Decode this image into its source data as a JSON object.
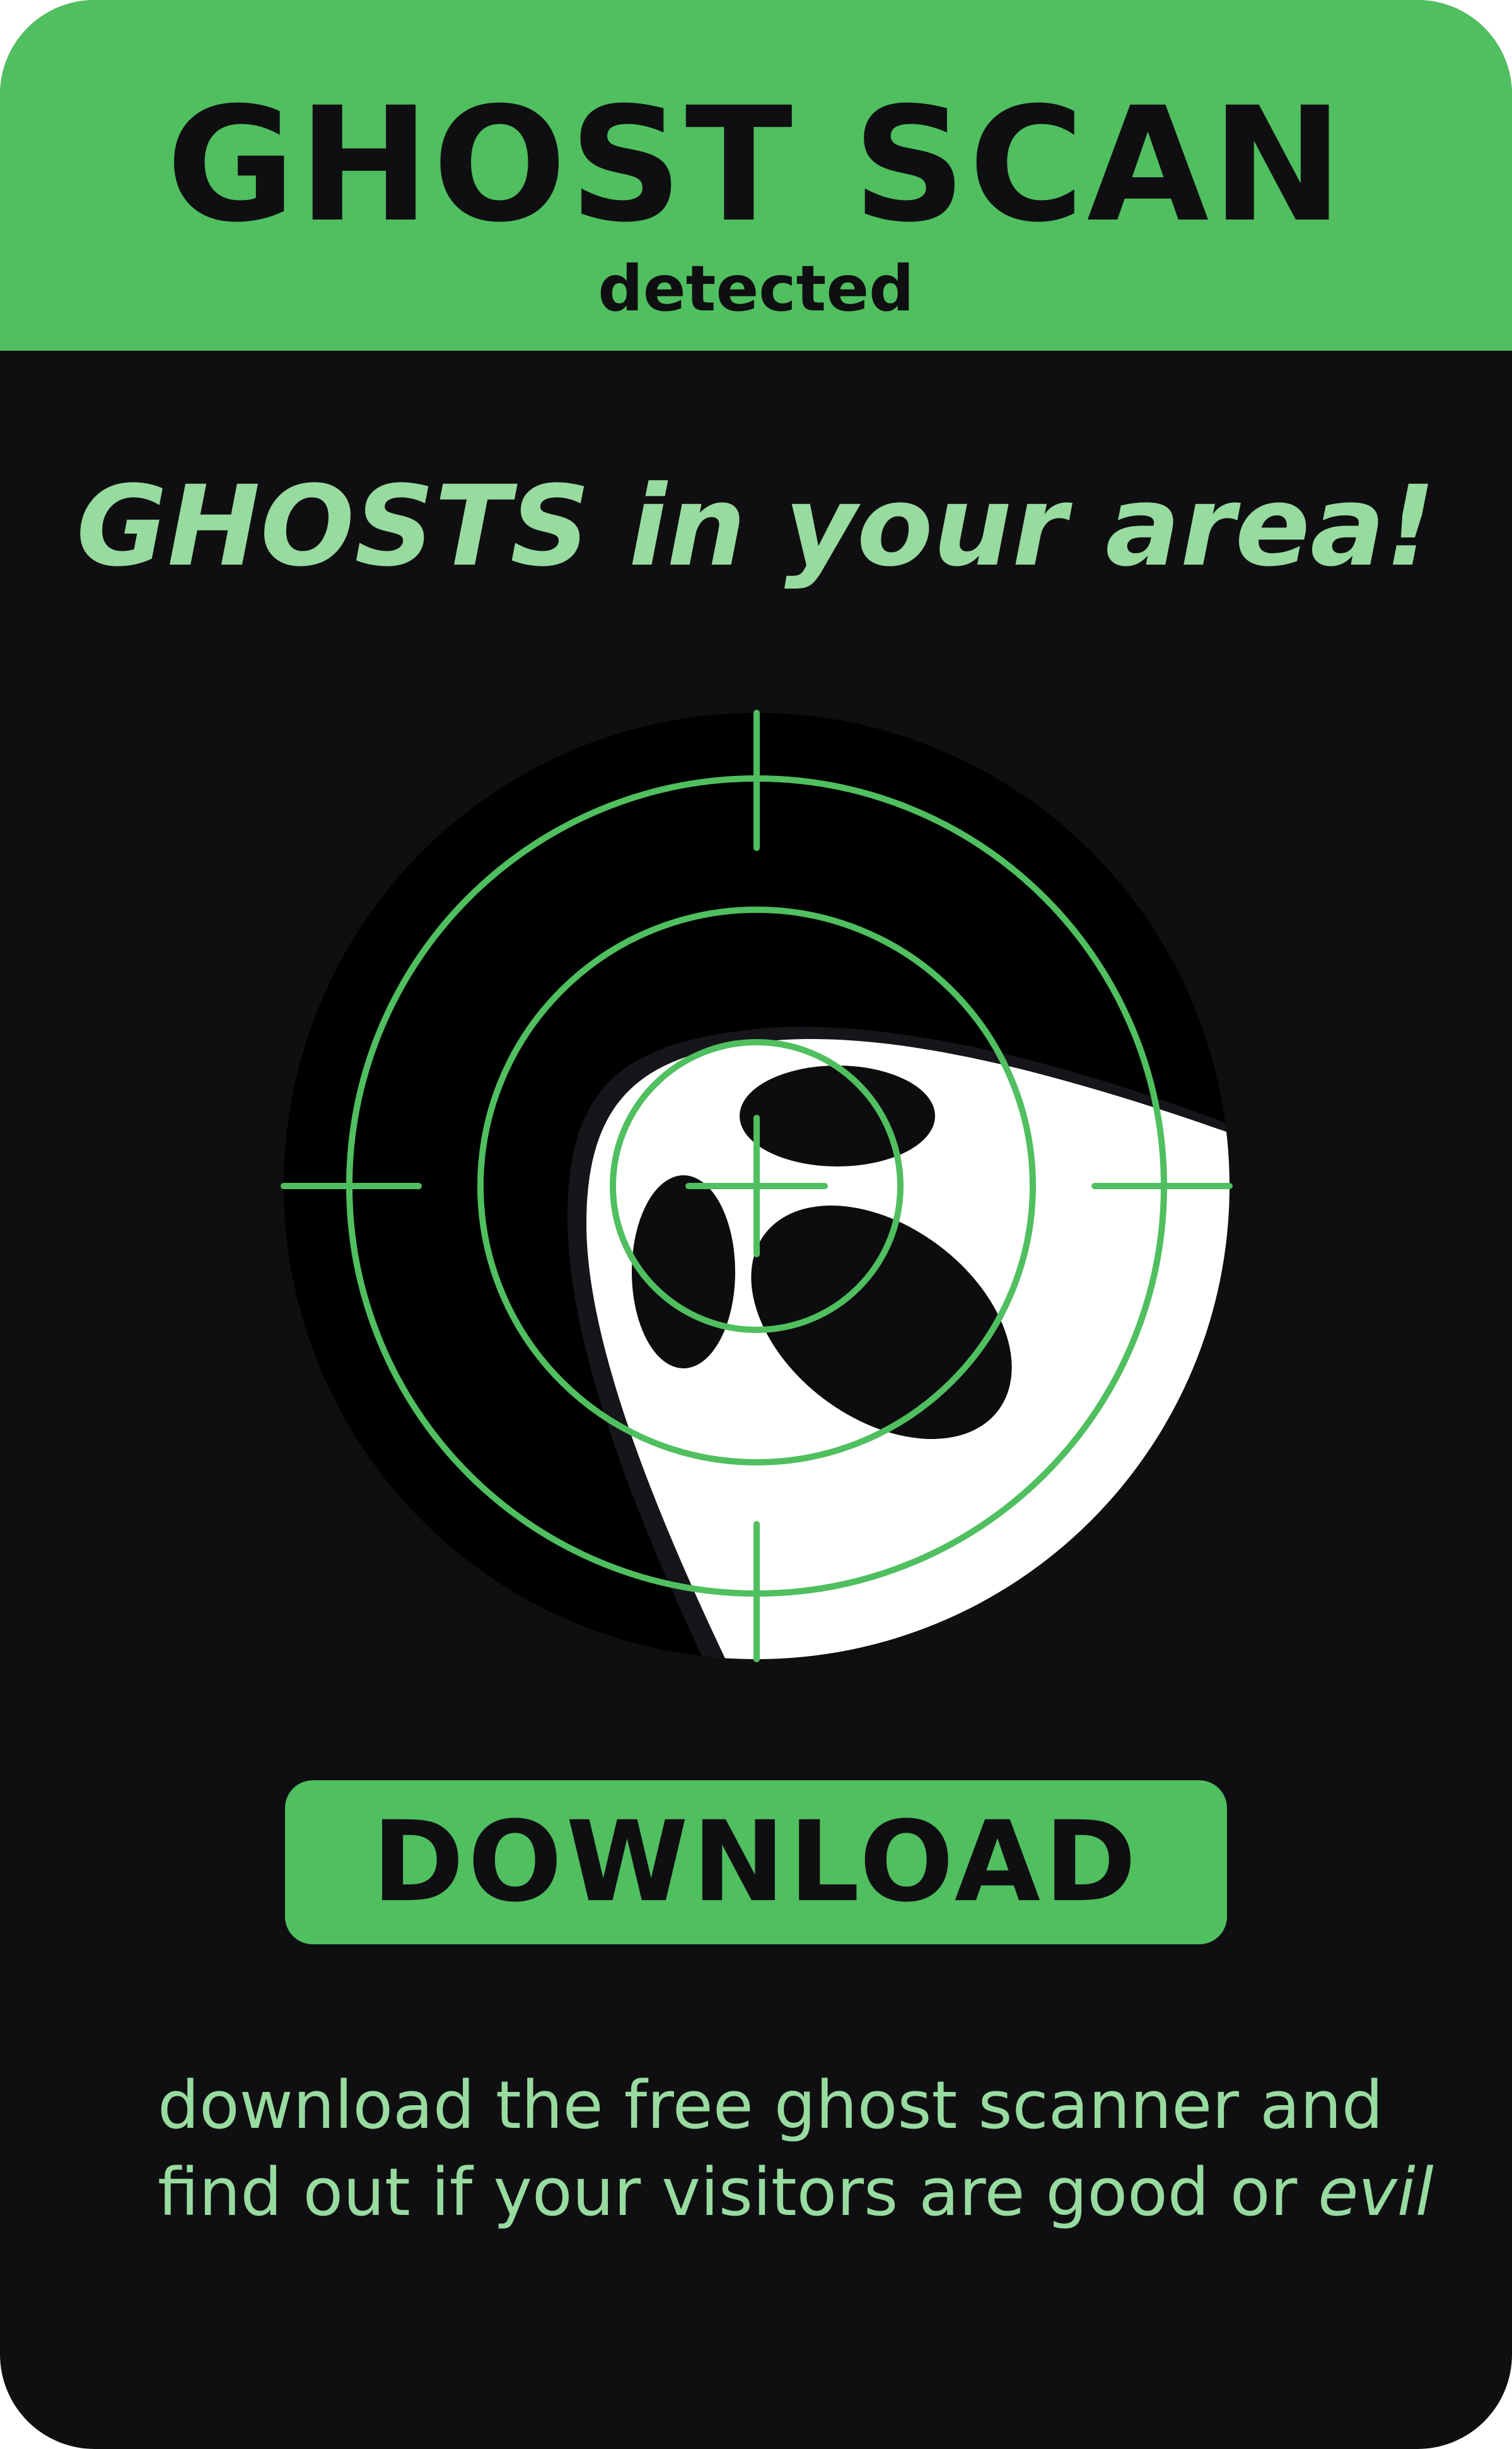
{
  "colors": {
    "accent_green": "#50bf5f",
    "light_green": "#98db9f",
    "background": "#0f0f12",
    "ghost_white": "#ffffff"
  },
  "header": {
    "title": "GHOST SCAN",
    "subtitle": "detected"
  },
  "main": {
    "headline": "GHOSTS in your area!",
    "scanner": {
      "icons": [
        "crosshair-icon",
        "ghost-icon"
      ]
    },
    "download_button": {
      "label": "DOWNLOAD"
    },
    "description": {
      "line1": "download the free ghost scanner and",
      "line2_prefix": "find out if your visitors are good or ",
      "line2_emphasis": "evil"
    }
  }
}
